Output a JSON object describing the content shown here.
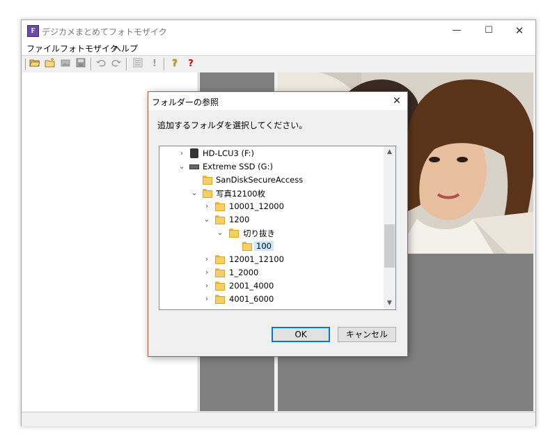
{
  "window": {
    "title": "デジカメまとめてフォトモザイク",
    "app_icon_letter": "F",
    "controls": {
      "minimize": "—",
      "maximize": "☐",
      "close": "✕"
    }
  },
  "menu": [
    "ファイル",
    "フォトモザイク",
    "ヘルプ"
  ],
  "toolbar": {
    "icons": [
      "open-folder-icon",
      "new-folder-icon",
      "image-icon",
      "save-icon",
      "undo-icon",
      "redo-icon",
      "list-icon",
      "exclamation-icon",
      "help-icon",
      "context-help-icon"
    ],
    "glyphs": {
      "exclamation": "!",
      "help": "?",
      "context_help": "?"
    }
  },
  "dialog": {
    "title": "フォルダーの参照",
    "close": "✕",
    "prompt": "追加するフォルダを選択してください。",
    "tree": [
      {
        "label": "HD-LCU3 (F:)",
        "expanded": false,
        "type": "drive"
      },
      {
        "label": "Extreme SSD (G:)",
        "expanded": true,
        "type": "drive"
      },
      {
        "label": "SanDiskSecureAccess",
        "type": "folder"
      },
      {
        "label": "写真12100枚",
        "expanded": true,
        "type": "folder"
      },
      {
        "label": "10001_12000",
        "expanded": false,
        "type": "folder"
      },
      {
        "label": "1200",
        "expanded": true,
        "type": "folder"
      },
      {
        "label": "切り抜き",
        "expanded": true,
        "type": "folder"
      },
      {
        "label": "100",
        "selected": true,
        "type": "folder"
      },
      {
        "label": "12001_12100",
        "expanded": false,
        "type": "folder"
      },
      {
        "label": "1_2000",
        "expanded": false,
        "type": "folder"
      },
      {
        "label": "2001_4000",
        "expanded": false,
        "type": "folder"
      },
      {
        "label": "4001_6000",
        "expanded": false,
        "type": "folder"
      }
    ],
    "scroll": {
      "up": "▲",
      "down": "▼"
    },
    "ok_label": "OK",
    "cancel_label": "キャンセル"
  },
  "colors": {
    "selection": "#cce8ff",
    "folder": "#f5cf62",
    "panel_gray": "#808080",
    "ok_border": "#0078d7",
    "dialog_border": "#b05a3a"
  }
}
